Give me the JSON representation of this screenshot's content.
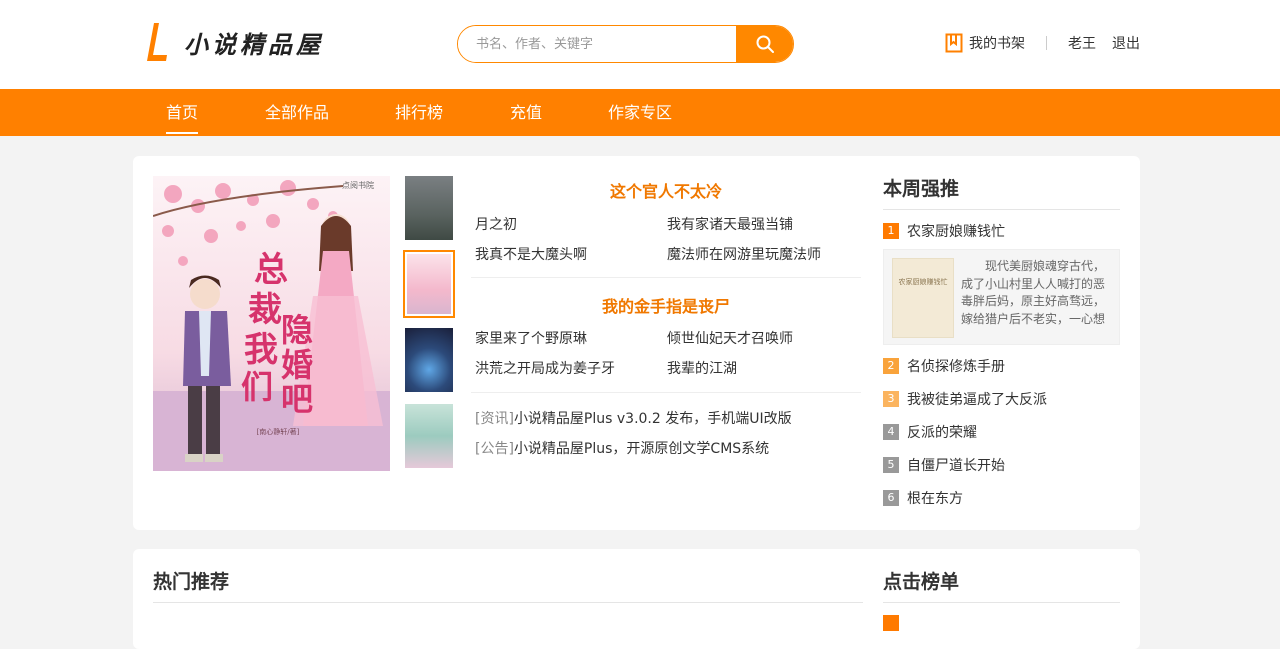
{
  "header": {
    "logo_text": "小说精品屋",
    "search_placeholder": "书名、作者、关键字",
    "shelf_label": "我的书架",
    "user_name": "老王",
    "logout_label": "退出"
  },
  "nav": {
    "items": [
      "首页",
      "全部作品",
      "排行榜",
      "充值",
      "作家专区"
    ],
    "active_index": 0
  },
  "colors": {
    "accent": "#ff8000",
    "rank_top": "#ff7a00",
    "rank_second": "#f9a33b",
    "rank_third": "#fbb45f",
    "rank_rest": "#999999"
  },
  "featured": {
    "cover_title_lines": [
      "总",
      "裁",
      "我",
      "们",
      "隐",
      "婚",
      "吧"
    ],
    "cover_publisher": "点阅书院",
    "cover_author": "[南心静轩/著]"
  },
  "thumbs": {
    "icons": [
      "thumb-dark-sky",
      "thumb-pink-cover",
      "thumb-blue-figure",
      "thumb-green-figure"
    ]
  },
  "list": {
    "group1_title": "这个官人不太冷",
    "group1_items": [
      "月之初",
      "我有家诸天最强当铺",
      "我真不是大魔头啊",
      "魔法师在网游里玩魔法师"
    ],
    "group2_title": "我的金手指是丧尸",
    "group2_items": [
      "家里来了个野原琳",
      "倾世仙妃天才召唤师",
      "洪荒之开局成为姜子牙",
      "我辈的江湖"
    ],
    "news": [
      {
        "tag": "[资讯]",
        "text": "小说精品屋Plus v3.0.2 发布，手机端UI改版"
      },
      {
        "tag": "[公告]",
        "text": "小说精品屋Plus，开源原创文学CMS系统"
      }
    ]
  },
  "weekly": {
    "title": "本周强推",
    "items": [
      {
        "num": "1",
        "name": "农家厨娘赚钱忙"
      },
      {
        "num": "2",
        "name": "名侦探修炼手册"
      },
      {
        "num": "3",
        "name": "我被徒弟逼成了大反派"
      },
      {
        "num": "4",
        "name": "反派的荣耀"
      },
      {
        "num": "5",
        "name": "自僵尸道长开始"
      },
      {
        "num": "6",
        "name": "根在东方"
      }
    ],
    "top_desc": "现代美厨娘魂穿古代，成了小山村里人人喊打的恶毒胖后妈，原主好高骛远，嫁给猎户后不老实，一心想要",
    "mini_cover_title": "农家厨娘赚钱忙"
  },
  "hot": {
    "title": "热门推荐"
  },
  "clicks": {
    "title": "点击榜单"
  }
}
